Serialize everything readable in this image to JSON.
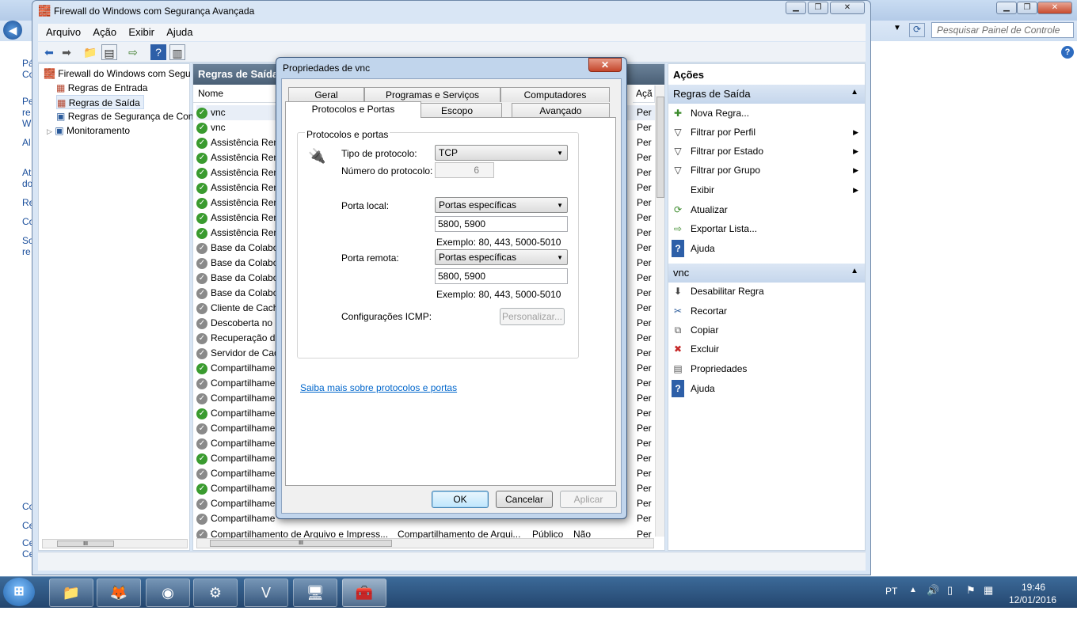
{
  "bg": {
    "search_placeholder": "Pesquisar Painel de Controle",
    "left_fragments": [
      "Pá",
      "Co",
      "Pe",
      "re",
      "W",
      "Al",
      "At",
      "do",
      "Re",
      "Co",
      "So",
      "re",
      "Co",
      "Ce",
      "Ce",
      "Ce"
    ]
  },
  "window": {
    "title": "Firewall do Windows com Segurança Avançada",
    "menu": [
      "Arquivo",
      "Ação",
      "Exibir",
      "Ajuda"
    ]
  },
  "tree": {
    "root": "Firewall do Windows com Segu",
    "items": [
      "Regras de Entrada",
      "Regras de Saída",
      "Regras de Segurança de Con",
      "Monitoramento"
    ]
  },
  "list": {
    "header": "Regras de Saída",
    "col_name": "Nome",
    "col_action": "Açã",
    "rows": [
      {
        "name": "vnc",
        "status": "ok",
        "action": "Per"
      },
      {
        "name": "vnc",
        "status": "ok",
        "action": "Per"
      },
      {
        "name": "Assistência Ren",
        "status": "ok",
        "action": "Per"
      },
      {
        "name": "Assistência Ren",
        "status": "ok",
        "action": "Per"
      },
      {
        "name": "Assistência Ren",
        "status": "ok",
        "action": "Per"
      },
      {
        "name": "Assistência Ren",
        "status": "ok",
        "action": "Per"
      },
      {
        "name": "Assistência Ren",
        "status": "ok",
        "action": "Per"
      },
      {
        "name": "Assistência Ren",
        "status": "ok",
        "action": "Per"
      },
      {
        "name": "Assistência Ren",
        "status": "ok",
        "action": "Per"
      },
      {
        "name": "Base da Colabo",
        "status": "gray",
        "action": "Per"
      },
      {
        "name": "Base da Colabo",
        "status": "gray",
        "action": "Per"
      },
      {
        "name": "Base da Colabo",
        "status": "gray",
        "action": "Per"
      },
      {
        "name": "Base da Colabo",
        "status": "gray",
        "action": "Per"
      },
      {
        "name": "Cliente de Cach",
        "status": "gray",
        "action": "Per"
      },
      {
        "name": "Descoberta no",
        "status": "gray",
        "action": "Per"
      },
      {
        "name": "Recuperação d",
        "status": "gray",
        "action": "Per"
      },
      {
        "name": "Servidor de Cac",
        "status": "gray",
        "action": "Per"
      },
      {
        "name": "Compartilhame",
        "status": "ok",
        "action": "Per"
      },
      {
        "name": "Compartilhame",
        "status": "gray",
        "action": "Per"
      },
      {
        "name": "Compartilhame",
        "status": "gray",
        "action": "Per"
      },
      {
        "name": "Compartilhame",
        "status": "ok",
        "action": "Per"
      },
      {
        "name": "Compartilhame",
        "status": "gray",
        "action": "Per"
      },
      {
        "name": "Compartilhame",
        "status": "gray",
        "action": "Per"
      },
      {
        "name": "Compartilhame",
        "status": "ok",
        "action": "Per"
      },
      {
        "name": "Compartilhame",
        "status": "gray",
        "action": "Per"
      },
      {
        "name": "Compartilhame",
        "status": "ok",
        "action": "Per"
      },
      {
        "name": "Compartilhame",
        "status": "gray",
        "action": "Per"
      },
      {
        "name": "Compartilhame",
        "status": "gray",
        "action": "Per"
      }
    ],
    "last_row": {
      "name": "Compartilhamento de Arquivo e Impress...",
      "group": "Compartilhamento de Arqui...",
      "profile": "Público",
      "enabled": "Não",
      "action": "Per"
    },
    "hscroll_label": "III"
  },
  "actions": {
    "title": "Ações",
    "section1": "Regras de Saída",
    "section1_items": [
      {
        "label": "Nova Regra...",
        "icon": "new-rule-icon",
        "arrow": false
      },
      {
        "label": "Filtrar por Perfil",
        "icon": "filter-icon",
        "arrow": true
      },
      {
        "label": "Filtrar por Estado",
        "icon": "filter-icon",
        "arrow": true
      },
      {
        "label": "Filtrar por Grupo",
        "icon": "filter-icon",
        "arrow": true
      },
      {
        "label": "Exibir",
        "icon": "",
        "arrow": true
      },
      {
        "label": "Atualizar",
        "icon": "refresh-icon",
        "arrow": false
      },
      {
        "label": "Exportar Lista...",
        "icon": "export-icon",
        "arrow": false
      },
      {
        "label": "Ajuda",
        "icon": "help-icon",
        "arrow": false
      }
    ],
    "section2": "vnc",
    "section2_items": [
      {
        "label": "Desabilitar Regra",
        "icon": "disable-icon"
      },
      {
        "label": "Recortar",
        "icon": "cut-icon"
      },
      {
        "label": "Copiar",
        "icon": "copy-icon"
      },
      {
        "label": "Excluir",
        "icon": "delete-icon"
      },
      {
        "label": "Propriedades",
        "icon": "properties-icon"
      },
      {
        "label": "Ajuda",
        "icon": "help-icon"
      }
    ]
  },
  "dialog": {
    "title": "Propriedades de vnc",
    "close": "✕",
    "tabs_back": [
      "Geral",
      "Programas e Serviços",
      "Computadores"
    ],
    "tabs_front": [
      "Protocolos e Portas",
      "Escopo",
      "Avançado"
    ],
    "group_label": "Protocolos e portas",
    "protocol_type_label": "Tipo de protocolo:",
    "protocol_type_value": "TCP",
    "protocol_number_label": "Número do protocolo:",
    "protocol_number_value": "6",
    "local_port_label": "Porta local:",
    "local_port_select": "Portas específicas",
    "local_port_value": "5800, 5900",
    "local_port_example": "Exemplo: 80, 443, 5000-5010",
    "remote_port_label": "Porta remota:",
    "remote_port_select": "Portas específicas",
    "remote_port_value": "5800, 5900",
    "remote_port_example": "Exemplo: 80, 443, 5000-5010",
    "icmp_label": "Configurações ICMP:",
    "customize": "Personalizar...",
    "learn_more": "Saiba mais sobre protocolos e portas",
    "ok": "OK",
    "cancel": "Cancelar",
    "apply": "Aplicar"
  },
  "tray": {
    "lang": "PT",
    "time": "19:46",
    "date": "12/01/2016"
  }
}
